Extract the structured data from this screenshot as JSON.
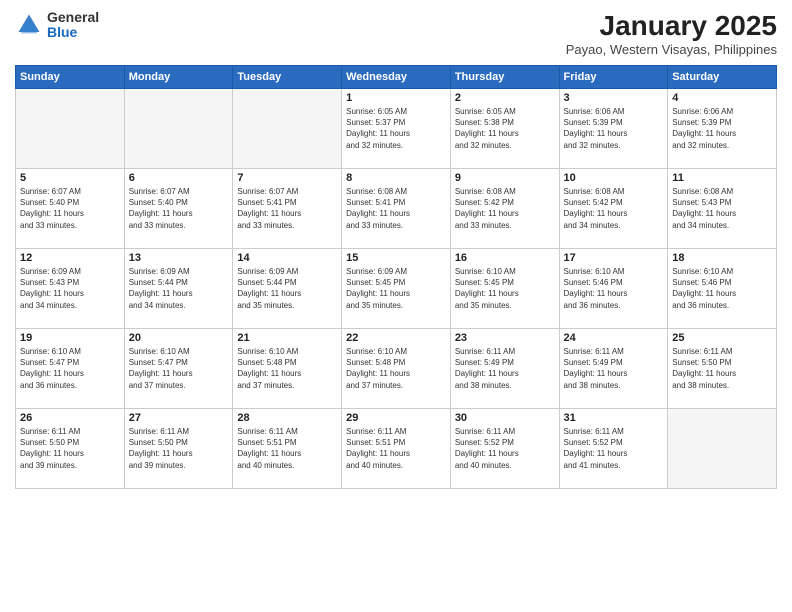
{
  "header": {
    "logo_general": "General",
    "logo_blue": "Blue",
    "month_title": "January 2025",
    "location": "Payao, Western Visayas, Philippines"
  },
  "weekdays": [
    "Sunday",
    "Monday",
    "Tuesday",
    "Wednesday",
    "Thursday",
    "Friday",
    "Saturday"
  ],
  "weeks": [
    [
      {
        "day": "",
        "info": ""
      },
      {
        "day": "",
        "info": ""
      },
      {
        "day": "",
        "info": ""
      },
      {
        "day": "1",
        "info": "Sunrise: 6:05 AM\nSunset: 5:37 PM\nDaylight: 11 hours\nand 32 minutes."
      },
      {
        "day": "2",
        "info": "Sunrise: 6:05 AM\nSunset: 5:38 PM\nDaylight: 11 hours\nand 32 minutes."
      },
      {
        "day": "3",
        "info": "Sunrise: 6:06 AM\nSunset: 5:39 PM\nDaylight: 11 hours\nand 32 minutes."
      },
      {
        "day": "4",
        "info": "Sunrise: 6:06 AM\nSunset: 5:39 PM\nDaylight: 11 hours\nand 32 minutes."
      }
    ],
    [
      {
        "day": "5",
        "info": "Sunrise: 6:07 AM\nSunset: 5:40 PM\nDaylight: 11 hours\nand 33 minutes."
      },
      {
        "day": "6",
        "info": "Sunrise: 6:07 AM\nSunset: 5:40 PM\nDaylight: 11 hours\nand 33 minutes."
      },
      {
        "day": "7",
        "info": "Sunrise: 6:07 AM\nSunset: 5:41 PM\nDaylight: 11 hours\nand 33 minutes."
      },
      {
        "day": "8",
        "info": "Sunrise: 6:08 AM\nSunset: 5:41 PM\nDaylight: 11 hours\nand 33 minutes."
      },
      {
        "day": "9",
        "info": "Sunrise: 6:08 AM\nSunset: 5:42 PM\nDaylight: 11 hours\nand 33 minutes."
      },
      {
        "day": "10",
        "info": "Sunrise: 6:08 AM\nSunset: 5:42 PM\nDaylight: 11 hours\nand 34 minutes."
      },
      {
        "day": "11",
        "info": "Sunrise: 6:08 AM\nSunset: 5:43 PM\nDaylight: 11 hours\nand 34 minutes."
      }
    ],
    [
      {
        "day": "12",
        "info": "Sunrise: 6:09 AM\nSunset: 5:43 PM\nDaylight: 11 hours\nand 34 minutes."
      },
      {
        "day": "13",
        "info": "Sunrise: 6:09 AM\nSunset: 5:44 PM\nDaylight: 11 hours\nand 34 minutes."
      },
      {
        "day": "14",
        "info": "Sunrise: 6:09 AM\nSunset: 5:44 PM\nDaylight: 11 hours\nand 35 minutes."
      },
      {
        "day": "15",
        "info": "Sunrise: 6:09 AM\nSunset: 5:45 PM\nDaylight: 11 hours\nand 35 minutes."
      },
      {
        "day": "16",
        "info": "Sunrise: 6:10 AM\nSunset: 5:45 PM\nDaylight: 11 hours\nand 35 minutes."
      },
      {
        "day": "17",
        "info": "Sunrise: 6:10 AM\nSunset: 5:46 PM\nDaylight: 11 hours\nand 36 minutes."
      },
      {
        "day": "18",
        "info": "Sunrise: 6:10 AM\nSunset: 5:46 PM\nDaylight: 11 hours\nand 36 minutes."
      }
    ],
    [
      {
        "day": "19",
        "info": "Sunrise: 6:10 AM\nSunset: 5:47 PM\nDaylight: 11 hours\nand 36 minutes."
      },
      {
        "day": "20",
        "info": "Sunrise: 6:10 AM\nSunset: 5:47 PM\nDaylight: 11 hours\nand 37 minutes."
      },
      {
        "day": "21",
        "info": "Sunrise: 6:10 AM\nSunset: 5:48 PM\nDaylight: 11 hours\nand 37 minutes."
      },
      {
        "day": "22",
        "info": "Sunrise: 6:10 AM\nSunset: 5:48 PM\nDaylight: 11 hours\nand 37 minutes."
      },
      {
        "day": "23",
        "info": "Sunrise: 6:11 AM\nSunset: 5:49 PM\nDaylight: 11 hours\nand 38 minutes."
      },
      {
        "day": "24",
        "info": "Sunrise: 6:11 AM\nSunset: 5:49 PM\nDaylight: 11 hours\nand 38 minutes."
      },
      {
        "day": "25",
        "info": "Sunrise: 6:11 AM\nSunset: 5:50 PM\nDaylight: 11 hours\nand 38 minutes."
      }
    ],
    [
      {
        "day": "26",
        "info": "Sunrise: 6:11 AM\nSunset: 5:50 PM\nDaylight: 11 hours\nand 39 minutes."
      },
      {
        "day": "27",
        "info": "Sunrise: 6:11 AM\nSunset: 5:50 PM\nDaylight: 11 hours\nand 39 minutes."
      },
      {
        "day": "28",
        "info": "Sunrise: 6:11 AM\nSunset: 5:51 PM\nDaylight: 11 hours\nand 40 minutes."
      },
      {
        "day": "29",
        "info": "Sunrise: 6:11 AM\nSunset: 5:51 PM\nDaylight: 11 hours\nand 40 minutes."
      },
      {
        "day": "30",
        "info": "Sunrise: 6:11 AM\nSunset: 5:52 PM\nDaylight: 11 hours\nand 40 minutes."
      },
      {
        "day": "31",
        "info": "Sunrise: 6:11 AM\nSunset: 5:52 PM\nDaylight: 11 hours\nand 41 minutes."
      },
      {
        "day": "",
        "info": ""
      }
    ]
  ]
}
